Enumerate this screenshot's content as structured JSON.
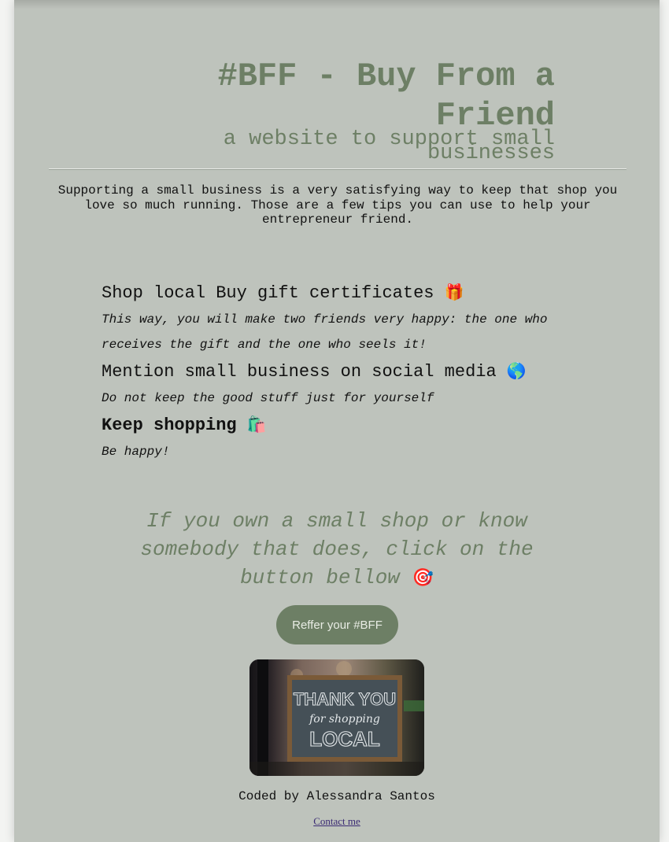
{
  "header": {
    "title": "#BFF - Buy From a Friend",
    "subtitle": "a website to support small businesses"
  },
  "intro": "Supporting a small business is a very satisfying way to keep that shop you love so much running. Those are a few tips you can use to help your entrepreneur friend.",
  "tips": [
    {
      "title": "Shop local Buy gift certificates",
      "icon": "🎁",
      "description": "This way, you will make two friends very happy: the one who receives the gift and the one who seels it!"
    },
    {
      "title": "Mention small business on social media",
      "icon": "🌎",
      "description": "Do not keep the good stuff just for yourself"
    },
    {
      "title": "Keep shopping",
      "icon": "🛍️",
      "description": "Be happy!"
    }
  ],
  "cta": {
    "text": "If you own a small shop or know somebody that does, click on the button bellow",
    "icon": "🎯",
    "button_label": "Reffer your #BFF"
  },
  "photo": {
    "line1": "THANK YOU",
    "line2": "for shopping",
    "line3": "LOCAL"
  },
  "footer": {
    "credit": "Coded by Alessandra Santos",
    "contact_label": "Contact me"
  },
  "colors": {
    "page_bg": "#bec3bc",
    "accent": "#6d7f65",
    "text": "#111111",
    "link": "#3a2a73"
  }
}
